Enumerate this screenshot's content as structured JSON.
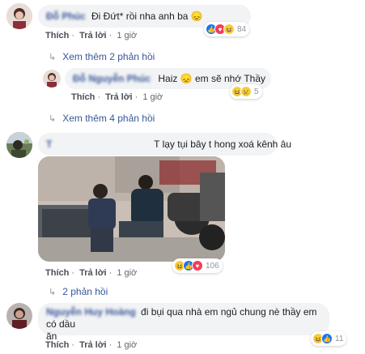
{
  "comments": [
    {
      "author": "Đỗ Phúc",
      "text": "Đi Đứt* rồi nha anh ba 😞",
      "actions": {
        "like": "Thích",
        "reply": "Trả lời",
        "time": "1 giờ"
      },
      "reaction_count": "84"
    },
    {
      "author": "Đỗ Nguyễn Phúc",
      "text": "Haiz 😞 em sẽ nhớ Thầy",
      "actions": {
        "like": "Thích",
        "reply": "Trả lời",
        "time": "1 giờ"
      },
      "reaction_count": "5"
    },
    {
      "author": "T",
      "text": "T lạy tụi bây t hong xoá kênh âu",
      "actions": {
        "like": "Thích",
        "reply": "Trả lời",
        "time": "1 giờ"
      },
      "reaction_count": "106"
    },
    {
      "author": "Nguyễn Huy Hoàng",
      "text_line1": "đi bụi qua nhà em ngủ chung nè thầy em có dầu",
      "text_line2": "ăn",
      "actions": {
        "like": "Thích",
        "reply": "Trả lời",
        "time": "1 giờ"
      },
      "reaction_count": "11"
    }
  ],
  "more_replies": [
    "Xem thêm 2 phản hồi",
    "Xem thêm 4 phản hồi",
    "2 phản hồi"
  ],
  "icons": {
    "reply_arrow": "↳"
  },
  "colors": {
    "link": "#385898",
    "bubble": "#f2f3f5",
    "meta": "#606770"
  }
}
